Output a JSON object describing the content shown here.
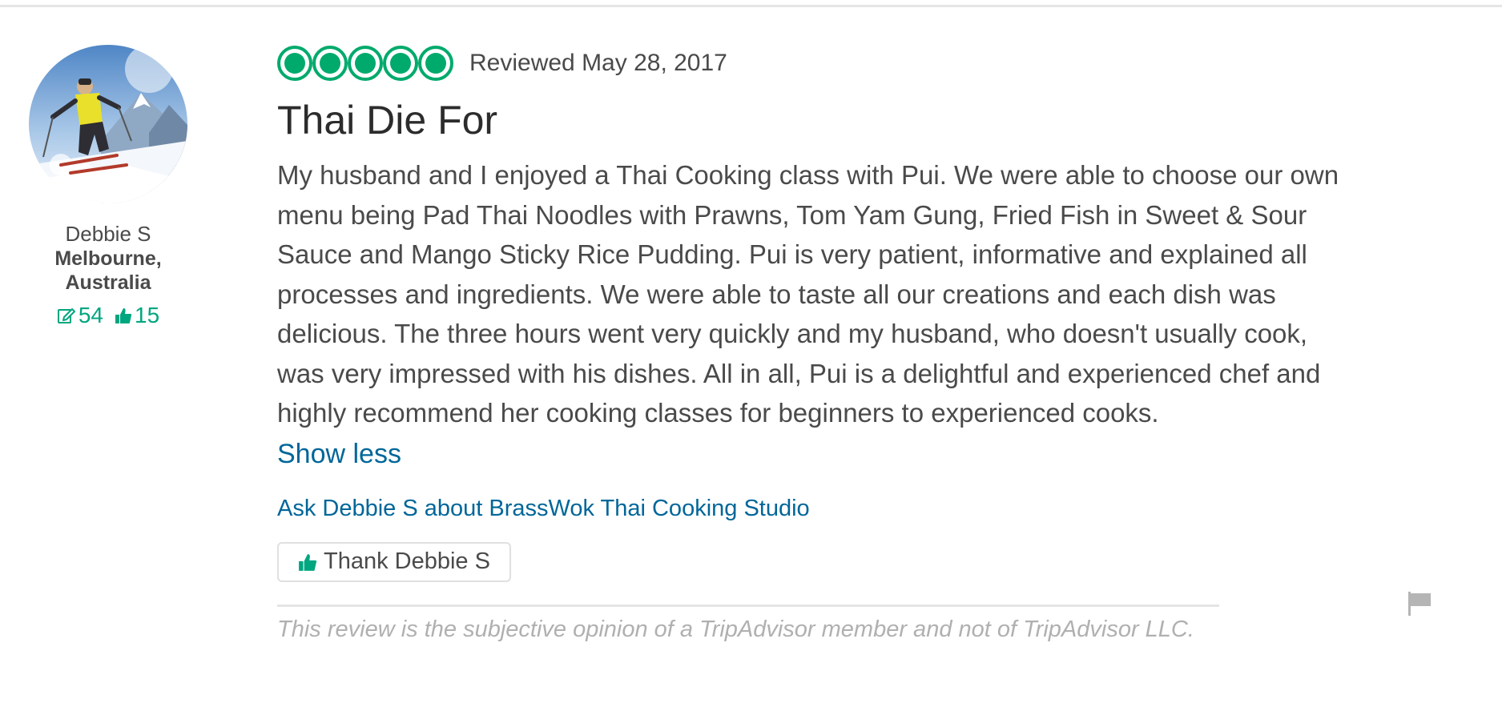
{
  "member": {
    "avatar_icon": "skier-avatar",
    "name": "Debbie S",
    "location": "Melbourne, Australia",
    "reviews_count": "54",
    "helpful_votes": "15",
    "accent_color": "#00a680"
  },
  "review": {
    "rating": 5,
    "rating_max": 5,
    "bubble_color": "#00aa6c",
    "date": "Reviewed May 28, 2017",
    "title": "Thai Die For",
    "body": "My husband and I enjoyed a Thai Cooking class with Pui. We were able to choose our own menu being Pad Thai Noodles with Prawns, Tom Yam Gung, Fried Fish in Sweet & Sour Sauce and Mango Sticky Rice Pudding. Pui is very patient, informative and explained all processes and ingredients. We were able to taste all our creations and each dish was delicious. The three hours went very quickly and my husband, who doesn't usually cook, was very impressed with his dishes. All in all, Pui is a delightful and experienced chef and highly recommend her cooking classes for beginners to experienced cooks.",
    "show_less": "Show less",
    "ask_link": "Ask Debbie S about BrassWok Thai Cooking Studio",
    "thank_button": "Thank Debbie S",
    "disclaimer": "This review is the subjective opinion of a TripAdvisor member and not of TripAdvisor LLC.",
    "link_color": "#006699"
  }
}
